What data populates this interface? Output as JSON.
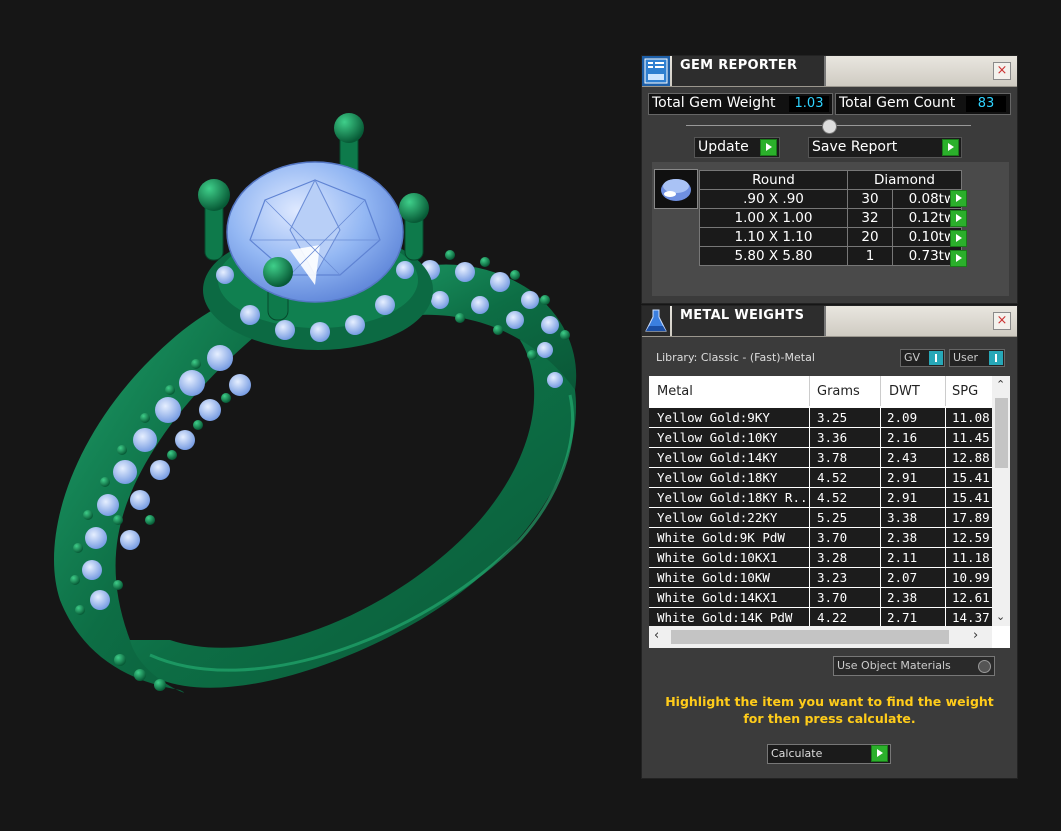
{
  "gem_reporter": {
    "title": "GEM REPORTER",
    "close": "×",
    "total_weight_label": "Total Gem Weight",
    "total_weight_value": "1.03",
    "total_count_label": "Total Gem Count",
    "total_count_value": "83",
    "update_label": "Update",
    "save_label": "Save Report",
    "shape": "Round",
    "material": "Diamond",
    "rows": [
      {
        "size": ".90 X .90",
        "count": "30",
        "tw": "0.08tw"
      },
      {
        "size": "1.00 X 1.00",
        "count": "32",
        "tw": "0.12tw"
      },
      {
        "size": "1.10 X 1.10",
        "count": "20",
        "tw": "0.10tw"
      },
      {
        "size": "5.80 X 5.80",
        "count": "1",
        "tw": "0.73tw"
      }
    ]
  },
  "metal_weights": {
    "title": "METAL WEIGHTS",
    "close": "×",
    "library": "Library: Classic - (Fast)-Metal",
    "gv_label": "GV",
    "user_label": "User",
    "columns": [
      "Metal",
      "Grams",
      "DWT",
      "SPG"
    ],
    "rows": [
      {
        "metal": "Yellow Gold:9KY",
        "grams": "3.25",
        "dwt": "2.09",
        "spg": "11.08"
      },
      {
        "metal": "Yellow Gold:10KY",
        "grams": "3.36",
        "dwt": "2.16",
        "spg": "11.45"
      },
      {
        "metal": "Yellow Gold:14KY",
        "grams": "3.78",
        "dwt": "2.43",
        "spg": "12.88"
      },
      {
        "metal": "Yellow Gold:18KY",
        "grams": "4.52",
        "dwt": "2.91",
        "spg": "15.41"
      },
      {
        "metal": "Yellow Gold:18KY R...",
        "grams": "4.52",
        "dwt": "2.91",
        "spg": "15.41"
      },
      {
        "metal": "Yellow Gold:22KY",
        "grams": "5.25",
        "dwt": "3.38",
        "spg": "17.89"
      },
      {
        "metal": "White Gold:9K PdW",
        "grams": "3.70",
        "dwt": "2.38",
        "spg": "12.59"
      },
      {
        "metal": "White Gold:10KX1",
        "grams": "3.28",
        "dwt": "2.11",
        "spg": "11.18"
      },
      {
        "metal": "White Gold:10KW",
        "grams": "3.23",
        "dwt": "2.07",
        "spg": "10.99"
      },
      {
        "metal": "White Gold:14KX1",
        "grams": "3.70",
        "dwt": "2.38",
        "spg": "12.61"
      },
      {
        "metal": "White Gold:14K PdW",
        "grams": "4.22",
        "dwt": "2.71",
        "spg": "14.37"
      }
    ],
    "use_object_materials": "Use Object Materials",
    "hint": "Highlight the item you want to find the weight for then press calculate.",
    "calculate_label": "Calculate"
  },
  "colors": {
    "metal_green": "#0f7a4e",
    "gem_blue": "#8fb6f2",
    "value_cyan": "#2fd3ff",
    "hint_yellow": "#ffcc1a",
    "go_green": "#2bb02b"
  }
}
